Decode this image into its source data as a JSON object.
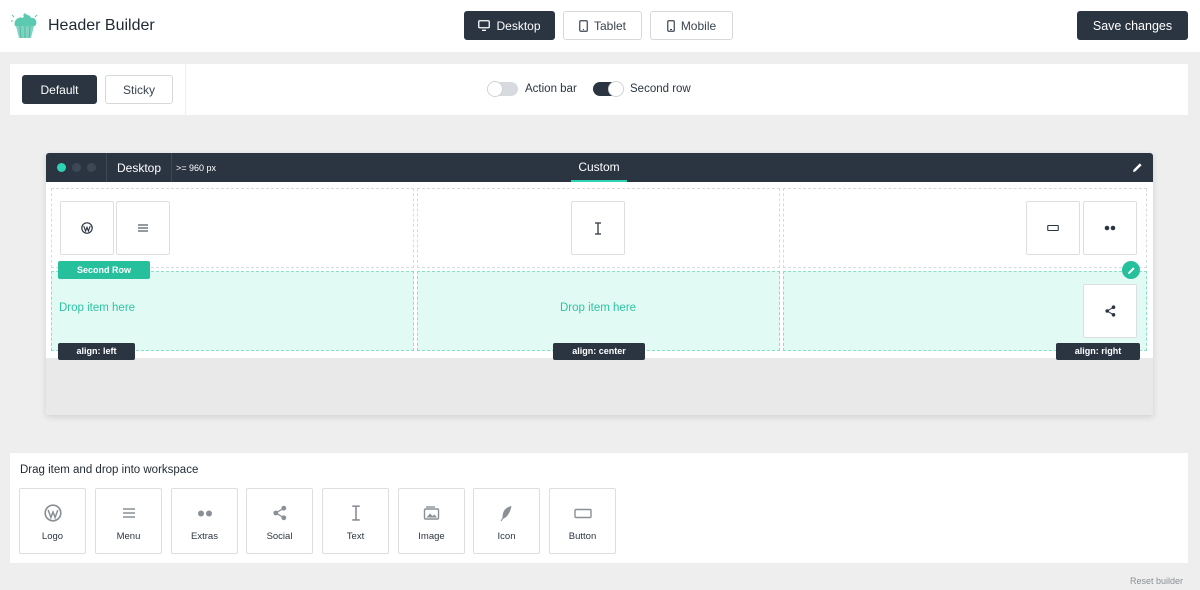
{
  "app": {
    "title": "Header Builder"
  },
  "devices": [
    {
      "label": "Desktop",
      "icon": "monitor-icon",
      "active": true
    },
    {
      "label": "Tablet",
      "icon": "tablet-icon",
      "active": false
    },
    {
      "label": "Mobile",
      "icon": "mobile-icon",
      "active": false
    }
  ],
  "save_label": "Save changes",
  "modes": {
    "default_label": "Default",
    "sticky_label": "Sticky"
  },
  "toggles": {
    "action_bar": {
      "label": "Action bar",
      "on": false
    },
    "second_row": {
      "label": "Second row",
      "on": true
    }
  },
  "canvas": {
    "device_label": "Desktop",
    "breakpoint": ">= 960 px",
    "tab_label": "Custom",
    "second_row_tag": "Second Row",
    "drop_left": "Drop item here",
    "drop_center": "Drop item here",
    "align_left": "align: left",
    "align_center": "align: center",
    "align_right": "align: right"
  },
  "palette": {
    "hint": "Drag item and drop into workspace",
    "items": [
      {
        "label": "Logo",
        "icon": "wordpress-icon"
      },
      {
        "label": "Menu",
        "icon": "menu-icon"
      },
      {
        "label": "Extras",
        "icon": "extras-icon"
      },
      {
        "label": "Social",
        "icon": "share-icon"
      },
      {
        "label": "Text",
        "icon": "text-cursor-icon"
      },
      {
        "label": "Image",
        "icon": "image-icon"
      },
      {
        "label": "Icon",
        "icon": "feather-icon"
      },
      {
        "label": "Button",
        "icon": "button-icon"
      }
    ]
  },
  "reset_label": "Reset builder",
  "colors": {
    "dark": "#2b3542",
    "accent": "#27c09c",
    "drop_bg": "#e2faf4"
  }
}
